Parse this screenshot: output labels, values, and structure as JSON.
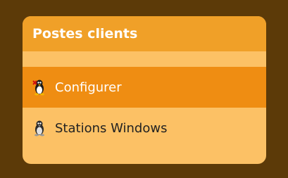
{
  "panel": {
    "title": "Postes clients",
    "items": [
      {
        "label": "Configurer",
        "icon": "tux-icon",
        "active": true
      },
      {
        "label": "Stations Windows",
        "icon": "tux-gray-icon",
        "active": false
      }
    ]
  },
  "colors": {
    "background": "#5c3a08",
    "header": "#f0a028",
    "panel_body": "#fcc165",
    "active_item": "#ef8d12"
  }
}
